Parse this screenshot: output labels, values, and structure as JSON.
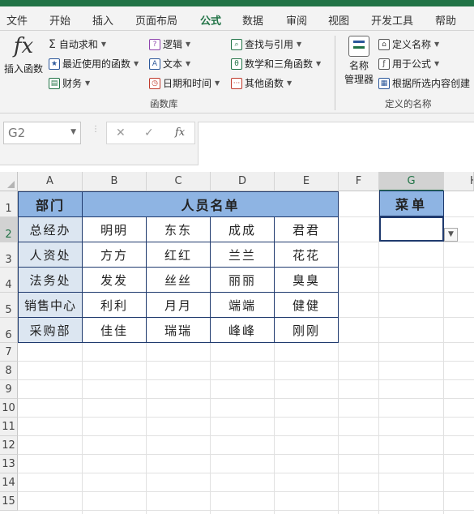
{
  "ribbon_tabs": [
    "文件",
    "开始",
    "插入",
    "页面布局",
    "公式",
    "数据",
    "审阅",
    "视图",
    "开发工具",
    "帮助"
  ],
  "ribbon": {
    "insert_function": {
      "icon": "fx-icon",
      "glyph": "fx",
      "label": "插入函数"
    },
    "autosum": "自动求和",
    "recent": "最近使用的函数",
    "financial": "财务",
    "logical": "逻辑",
    "text": "文本",
    "datetime": "日期和时间",
    "lookup": "查找与引用",
    "math": "数学和三角函数",
    "more": "其他函数",
    "library_label": "函数库",
    "name_manager_line1": "名称",
    "name_manager_line2": "管理器",
    "define_name": "定义名称",
    "use_in_formula": "用于公式",
    "create_from_selection": "根据所选内容创建",
    "defined_names_label": "定义的名称"
  },
  "formula_bar": {
    "name_box": "G2",
    "value": "",
    "fx": "fx"
  },
  "columns": [
    "A",
    "B",
    "C",
    "D",
    "E",
    "F",
    "G",
    "H"
  ],
  "rows": [
    "1",
    "2",
    "3",
    "4",
    "5",
    "6",
    "7",
    "8",
    "9",
    "10",
    "11",
    "12",
    "13",
    "14",
    "15"
  ],
  "sheet": {
    "header_dept": "部门",
    "header_staff": "人员名单",
    "departments": [
      "总经办",
      "人资处",
      "法务处",
      "销售中心",
      "采购部"
    ],
    "staff": [
      [
        "明明",
        "东东",
        "成成",
        "君君"
      ],
      [
        "方方",
        "红红",
        "兰兰",
        "花花"
      ],
      [
        "发发",
        "丝丝",
        "丽丽",
        "臭臭"
      ],
      [
        "利利",
        "月月",
        "端端",
        "健健"
      ],
      [
        "佳佳",
        "瑞瑞",
        "峰峰",
        "刚刚"
      ]
    ],
    "menu_header": "菜单",
    "menu_value": ""
  },
  "colors": {
    "accent": "#217346",
    "header_fill": "#8eb4e3",
    "dept_fill": "#dce6f1",
    "border": "#1f3a6e"
  }
}
